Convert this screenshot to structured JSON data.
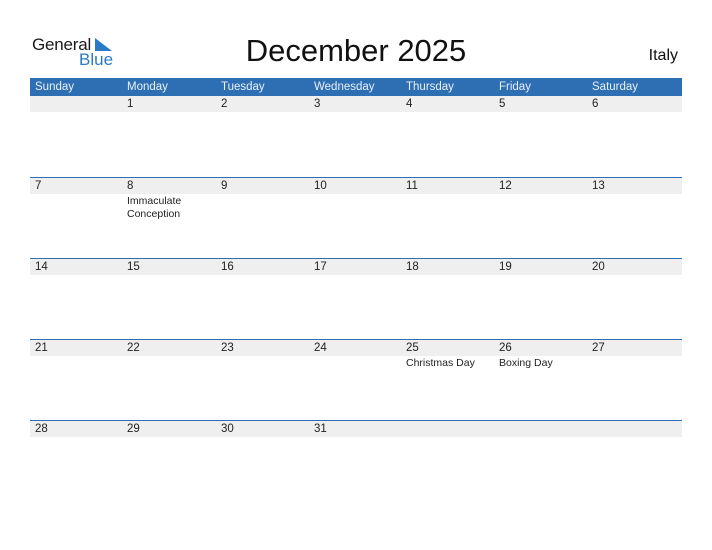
{
  "logo": {
    "general": "General",
    "blue": "Blue",
    "icon": "triangle-flag-icon",
    "brand_color": "#2a7ac7"
  },
  "header": {
    "title": "December 2025",
    "country": "Italy"
  },
  "colors": {
    "header_bar": "#2e6fb4",
    "date_band": "#efefef",
    "separator": "#2e6fb4"
  },
  "weekdays": [
    "Sunday",
    "Monday",
    "Tuesday",
    "Wednesday",
    "Thursday",
    "Friday",
    "Saturday"
  ],
  "weeks": [
    {
      "days": [
        "",
        "1",
        "2",
        "3",
        "4",
        "5",
        "6"
      ],
      "events": [
        "",
        "",
        "",
        "",
        "",
        "",
        ""
      ]
    },
    {
      "days": [
        "7",
        "8",
        "9",
        "10",
        "11",
        "12",
        "13"
      ],
      "events": [
        "",
        "Immaculate Conception",
        "",
        "",
        "",
        "",
        ""
      ]
    },
    {
      "days": [
        "14",
        "15",
        "16",
        "17",
        "18",
        "19",
        "20"
      ],
      "events": [
        "",
        "",
        "",
        "",
        "",
        "",
        ""
      ]
    },
    {
      "days": [
        "21",
        "22",
        "23",
        "24",
        "25",
        "26",
        "27"
      ],
      "events": [
        "",
        "",
        "",
        "",
        "Christmas Day",
        "Boxing Day",
        ""
      ]
    },
    {
      "days": [
        "28",
        "29",
        "30",
        "31",
        "",
        "",
        ""
      ],
      "events": [
        "",
        "",
        "",
        "",
        "",
        "",
        ""
      ]
    }
  ]
}
